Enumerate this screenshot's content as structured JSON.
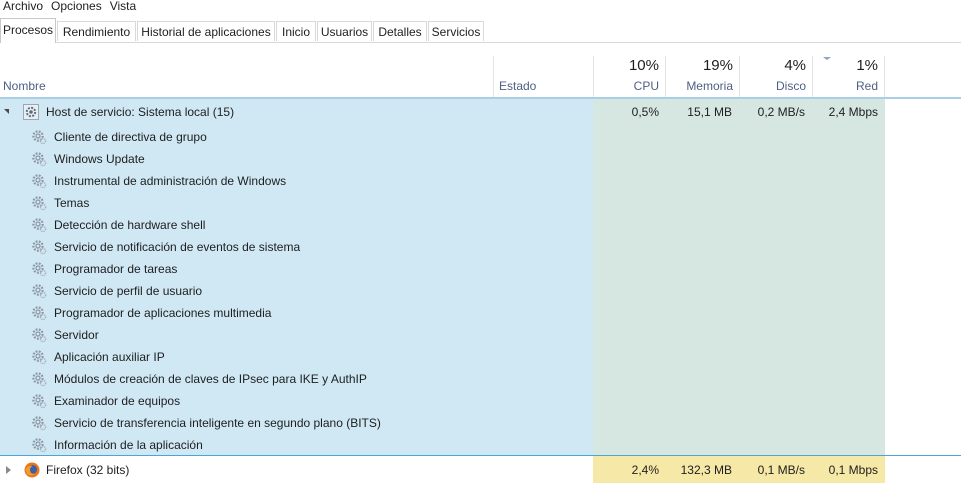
{
  "menu": [
    "Archivo",
    "Opciones",
    "Vista"
  ],
  "tabs": [
    "Procesos",
    "Rendimiento",
    "Historial de aplicaciones",
    "Inicio",
    "Usuarios",
    "Detalles",
    "Servicios"
  ],
  "active_tab": "Procesos",
  "columns": {
    "name": "Nombre",
    "status": "Estado",
    "cpu": {
      "pct": "10%",
      "label": "CPU"
    },
    "memory": {
      "pct": "19%",
      "label": "Memoria"
    },
    "disk": {
      "pct": "4%",
      "label": "Disco"
    },
    "network": {
      "pct": "1%",
      "label": "Red"
    }
  },
  "group": {
    "name": "Host de servicio: Sistema local (15)",
    "cpu": "0,5%",
    "memory": "15,1 MB",
    "disk": "0,2 MB/s",
    "network": "2,4 Mbps",
    "children": [
      "Cliente de directiva de grupo",
      "Windows Update",
      "Instrumental de administración de Windows",
      "Temas",
      "Detección de hardware shell",
      "Servicio de notificación de eventos de sistema",
      "Programador de tareas",
      "Servicio de perfil de usuario",
      "Programador de aplicaciones multimedia",
      "Servidor",
      "Aplicación auxiliar IP",
      "Módulos de creación de claves de IPsec para IKE y AuthIP",
      "Examinador de equipos",
      "Servicio de transferencia inteligente en segundo plano (BITS)",
      "Información de la aplicación"
    ]
  },
  "firefox": {
    "name": "Firefox (32 bits)",
    "cpu": "2,4%",
    "memory": "132,3 MB",
    "disk": "0,1 MB/s",
    "network": "0,1 Mbps"
  },
  "colors": {
    "selection": "#cfe8f4",
    "metric_light": "#d6e7e1",
    "metric_hot": "#f6e8a6",
    "header_line": "#a9cfe6"
  }
}
